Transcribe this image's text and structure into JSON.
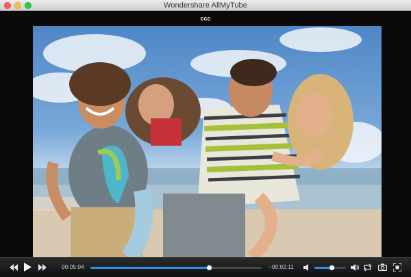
{
  "window": {
    "title": "Wondershare AllMyTube"
  },
  "player": {
    "video_title": "ccc"
  },
  "controls": {
    "elapsed": "00:05:04",
    "remaining": "−00:02:11",
    "progress": 0.69,
    "volume": 0.55
  },
  "icons": {
    "rewind": "rewind-icon",
    "play": "play-icon",
    "fast_forward": "fast-forward-icon",
    "volume_low": "volume-low-icon",
    "volume_high": "volume-high-icon",
    "loop": "loop-icon",
    "snapshot": "camera-icon",
    "fullscreen": "fullscreen-icon"
  },
  "colors": {
    "accent": "#2f8fe8",
    "bar_bg": "#1a1a1a"
  }
}
